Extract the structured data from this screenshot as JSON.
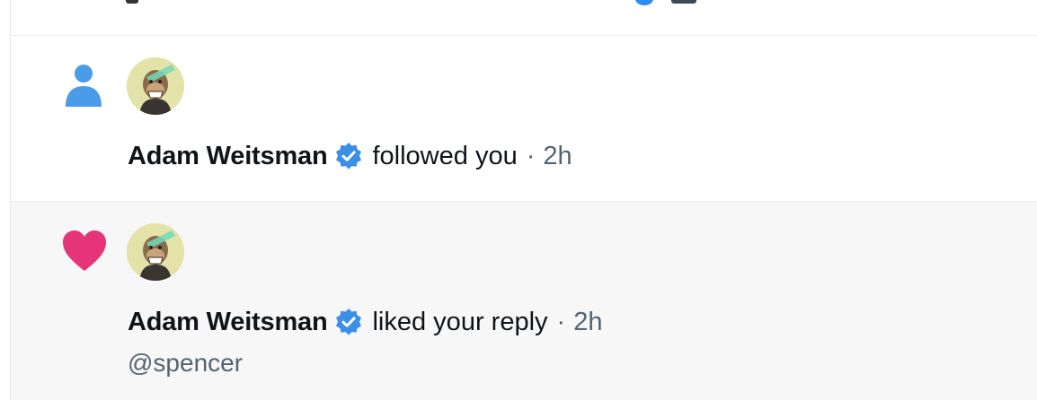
{
  "colors": {
    "follow_icon": "#4a9be8",
    "like_icon": "#e6347a",
    "verified_badge": "#3b8fe6",
    "secondary_text": "#536471"
  },
  "notifications": [
    {
      "type": "follow",
      "type_icon": "person-icon",
      "user_name": "Adam Weitsman",
      "verified": true,
      "action": "followed you",
      "separator": "·",
      "time": "2h"
    },
    {
      "type": "like",
      "type_icon": "heart-icon",
      "user_name": "Adam Weitsman",
      "verified": true,
      "action": "liked your reply",
      "separator": "·",
      "time": "2h",
      "reply_text": "@spencer"
    }
  ]
}
